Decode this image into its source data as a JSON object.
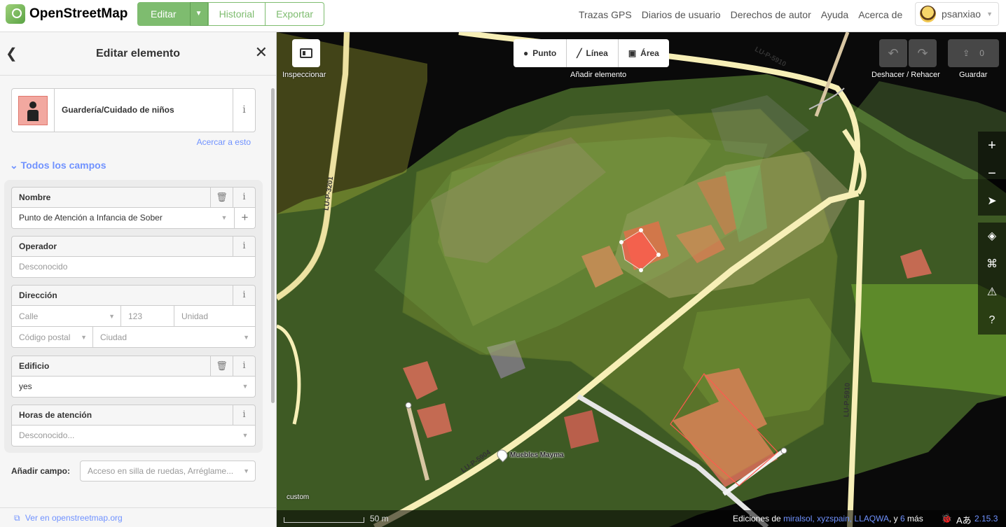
{
  "header": {
    "logo_text": "OpenStreetMap",
    "edit_label": "Editar",
    "history_label": "Historial",
    "export_label": "Exportar",
    "nav": [
      "Trazas GPS",
      "Diarios de usuario",
      "Derechos de autor",
      "Ayuda",
      "Acerca de"
    ],
    "username": "psanxiao"
  },
  "sidebar": {
    "title": "Editar elemento",
    "preset_name": "Guardería/Cuidado de niños",
    "zoom_link": "Acercar a esto",
    "all_fields_label": "Todos los campos",
    "fields": {
      "name": {
        "label": "Nombre",
        "value": "Punto de Atención a Infancia de Sober"
      },
      "operator": {
        "label": "Operador",
        "placeholder": "Desconocido"
      },
      "address": {
        "label": "Dirección",
        "street": "Calle",
        "number": "123",
        "unit": "Unidad",
        "postcode": "Código postal",
        "city": "Ciudad"
      },
      "building": {
        "label": "Edificio",
        "value": "yes"
      },
      "opening_hours": {
        "label": "Horas de atención",
        "placeholder": "Desconocido..."
      }
    },
    "add_field_label": "Añadir campo:",
    "add_field_placeholder": "Acceso en silla de ruedas, Arréglame...",
    "footer_link": "Ver en openstreetmap.org"
  },
  "map": {
    "inspect_label": "Inspeccionar",
    "add_point": "Punto",
    "add_line": "Línea",
    "add_area": "Área",
    "add_feature_label": "Añadir elemento",
    "undo_redo_label": "Deshacer / Rehacer",
    "save_label": "Guardar",
    "save_count": "0",
    "road_labels": {
      "lu_p_5910_top": "LU-P-5910",
      "lu_p_3201": "LU-P-3201",
      "lu_p_5910_right": "LU-P-5910",
      "lu_p_5904": "LU-P-5904"
    },
    "poi_label": "Muebles Mayma",
    "imagery_label": "custom",
    "scale": "50 m",
    "attribution_prefix": "Ediciones de",
    "attribution_users": "miralsol, xyzspain, LLAQWA",
    "attribution_and": ", y",
    "attribution_more_count": "6",
    "attribution_more": "más",
    "version": "2.15.3"
  },
  "colors": {
    "accent_green": "#7ebc6f",
    "link_blue": "#7092ff",
    "road_yellow": "#f7efb7"
  }
}
